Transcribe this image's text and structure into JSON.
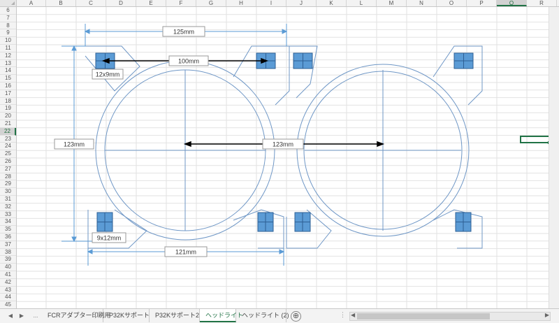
{
  "sheet": {
    "columns": [
      "A",
      "B",
      "C",
      "D",
      "E",
      "F",
      "G",
      "H",
      "I",
      "J",
      "K",
      "L",
      "M",
      "N",
      "O",
      "P",
      "Q",
      "R"
    ],
    "selected_column": "Q",
    "rows": [
      6,
      7,
      8,
      9,
      10,
      11,
      12,
      13,
      14,
      15,
      16,
      17,
      18,
      19,
      20,
      21,
      22,
      23,
      24,
      25,
      26,
      27,
      28,
      29,
      30,
      31,
      32,
      33,
      34,
      35,
      36,
      37,
      38,
      39,
      40,
      41,
      42,
      43,
      44,
      45
    ],
    "selected_row": 22
  },
  "drawing": {
    "labels": {
      "width_top": "125mm",
      "center_distance": "100mm",
      "tab_size_top": "12x9mm",
      "height_left": "123mm",
      "center_distance_2": "123mm",
      "tab_size_bottom": "9x12mm",
      "width_bottom": "121mm"
    },
    "line_color": "#6f97c6",
    "dim_color": "#5b9bd5",
    "square_color": "#5b9bd5"
  },
  "tabs": {
    "nav_prev": "◀",
    "nav_next": "▶",
    "more": "...",
    "items": [
      "FCRアダプター印刷用",
      "P32Kサポート",
      "P32Kサポート2",
      "ヘッドライト",
      "ヘッドライト (2)"
    ],
    "active_index": 3,
    "add_icon": "⊕"
  }
}
